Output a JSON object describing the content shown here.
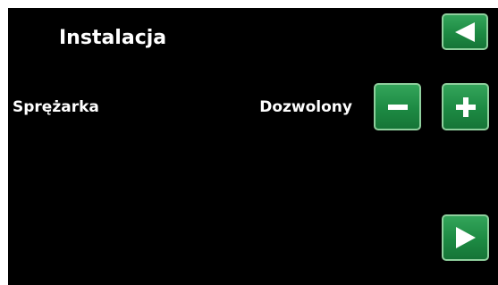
{
  "header": {
    "title": "Instalacja",
    "back_icon": "arrow-left-icon"
  },
  "setting": {
    "label": "Sprężarka",
    "value": "Dozwolony",
    "decrease_icon": "minus-icon",
    "increase_icon": "plus-icon"
  },
  "footer": {
    "next_icon": "arrow-right-icon"
  },
  "colors": {
    "background": "#000000",
    "text": "#ffffff",
    "button_green": "#22914a",
    "button_border": "#8fcf9d"
  }
}
